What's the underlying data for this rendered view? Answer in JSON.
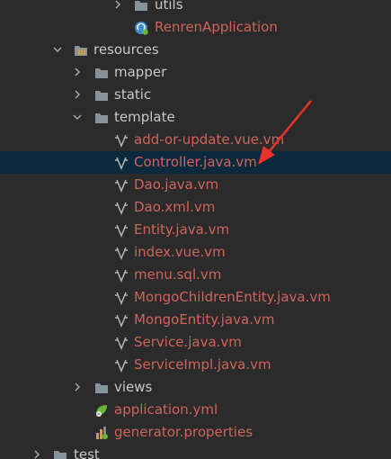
{
  "tree": {
    "utils_label": "utils",
    "renren_app_label": "RenrenApplication",
    "resources_label": "resources",
    "mapper_label": "mapper",
    "static_label": "static",
    "template_label": "template",
    "template_files": [
      "add-or-update.vue.vm",
      "Controller.java.vm",
      "Dao.java.vm",
      "Dao.xml.vm",
      "Entity.java.vm",
      "index.vue.vm",
      "menu.sql.vm",
      "MongoChildrenEntity.java.vm",
      "MongoEntity.java.vm",
      "Service.java.vm",
      "ServiceImpl.java.vm"
    ],
    "views_label": "views",
    "application_yml_label": "application.yml",
    "generator_props_label": "generator.properties",
    "test_label": "test",
    "selected_item": "Controller.java.vm"
  },
  "colors": {
    "background": "#2b2b2b",
    "selection": "#0d293e",
    "modified_file_text": "#d0645c",
    "folder_text": "#c9c9c9",
    "annotation_arrow": "#e8332a"
  },
  "icons": {
    "folder": "folder-icon",
    "resources_folder": "resources-folder-icon",
    "velocity_template": "velocity-template-icon",
    "spring_boot_app": "spring-boot-app-icon",
    "yaml_config": "spring-yaml-icon",
    "properties_file": "properties-file-icon",
    "collapsed": "chevron-right-icon",
    "expanded": "chevron-down-icon"
  }
}
